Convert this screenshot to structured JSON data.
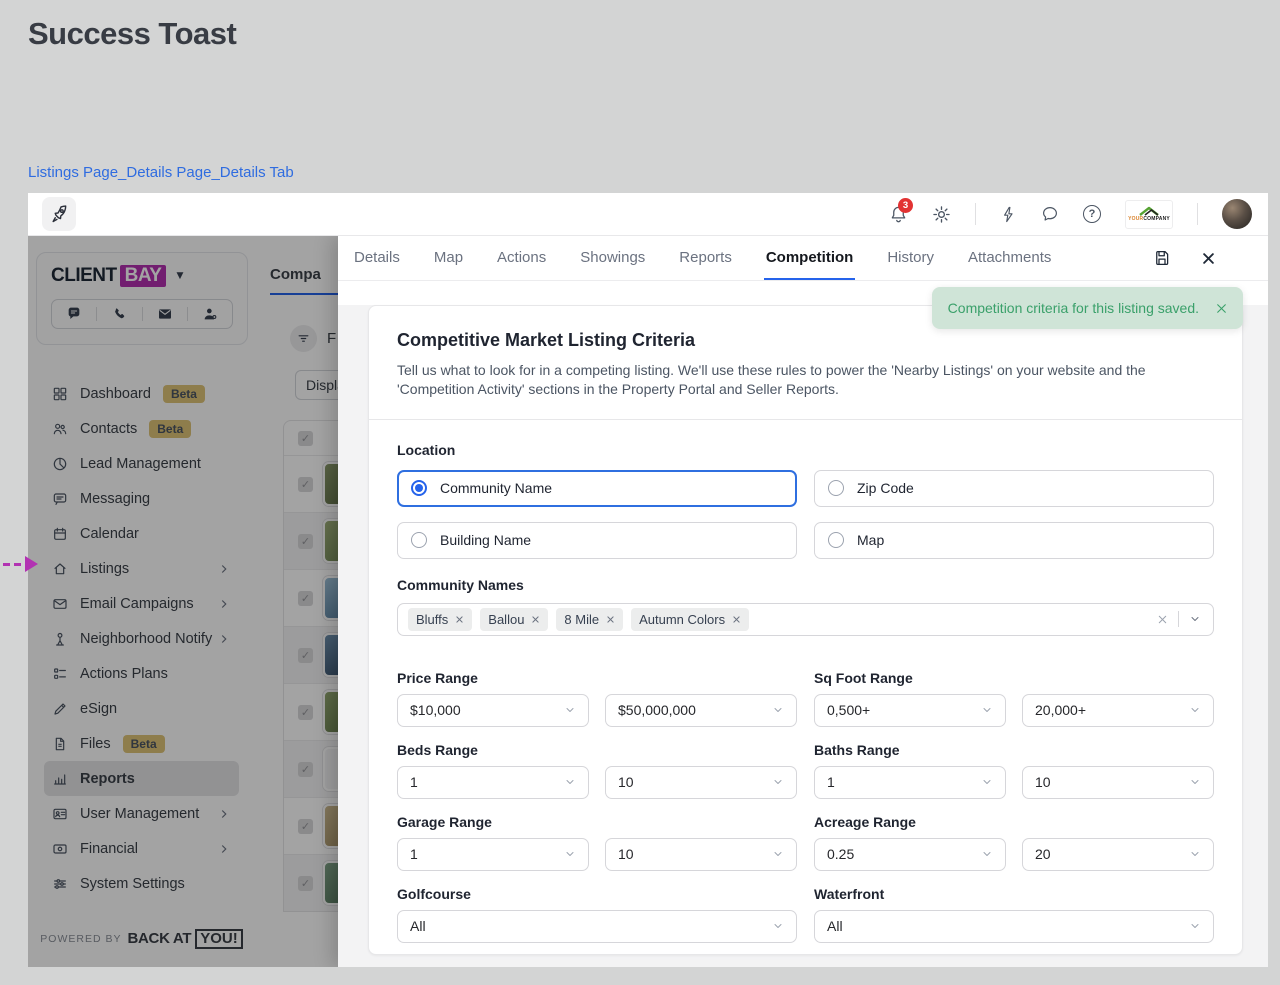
{
  "page": {
    "title": "Success Toast",
    "link_label": "Listings Page_Details Page_Details Tab"
  },
  "topbar": {
    "notification_count": "3",
    "logo_your": "YOUR",
    "logo_company": "COMPANY"
  },
  "sidebar": {
    "logo_client": "CLIENT",
    "logo_bay": "BAY",
    "items": [
      {
        "label": "Dashboard",
        "badge": "Beta"
      },
      {
        "label": "Contacts",
        "badge": "Beta"
      },
      {
        "label": "Lead Management"
      },
      {
        "label": "Messaging"
      },
      {
        "label": "Calendar"
      },
      {
        "label": "Listings"
      },
      {
        "label": "Email Campaigns"
      },
      {
        "label": "Neighborhood Notify"
      },
      {
        "label": "Actions Plans"
      },
      {
        "label": "eSign"
      },
      {
        "label": "Files",
        "badge": "Beta"
      },
      {
        "label": "Reports",
        "selected": true
      },
      {
        "label": "User Management"
      },
      {
        "label": "Financial"
      },
      {
        "label": "System Settings"
      }
    ],
    "powered_by": "POWERED BY",
    "brand_main": "BACK AT",
    "brand_box": "YOU!"
  },
  "background": {
    "tab_label": "Compa",
    "filter_label": "F",
    "display_label": "Displa"
  },
  "tabs": {
    "items": [
      "Details",
      "Map",
      "Actions",
      "Showings",
      "Reports",
      "Competition",
      "History",
      "Attachments"
    ],
    "active": "Competition"
  },
  "toast": {
    "message": "Competition criteria for this listing saved."
  },
  "form": {
    "title": "Competitive Market Listing Criteria",
    "description": "Tell us what to look for in a competing listing. We'll use these rules to power the 'Nearby Listings' on your website and the 'Competition Activity' sections in the Property Portal and Seller Reports.",
    "location_label": "Location",
    "location_options": [
      {
        "label": "Community Name",
        "selected": true
      },
      {
        "label": "Zip Code",
        "selected": false
      },
      {
        "label": "Building Name",
        "selected": false
      },
      {
        "label": "Map",
        "selected": false
      }
    ],
    "community_label": "Community Names",
    "community_tags": [
      "Bluffs",
      "Ballou",
      "8 Mile",
      "Autumn Colors"
    ],
    "ranges": [
      {
        "label": "Price Range",
        "min": "$10,000",
        "max": "$50,000,000"
      },
      {
        "label": "Sq Foot Range",
        "min": "0,500+",
        "max": "20,000+"
      },
      {
        "label": "Beds Range",
        "min": "1",
        "max": "10"
      },
      {
        "label": "Baths Range",
        "min": "1",
        "max": "10"
      },
      {
        "label": "Garage Range",
        "min": "1",
        "max": "10"
      },
      {
        "label": "Acreage Range",
        "min": "0.25",
        "max": "20"
      }
    ],
    "singles": [
      {
        "label": "Golfcourse",
        "value": "All"
      },
      {
        "label": "Waterfront",
        "value": "All"
      }
    ]
  },
  "colors": {
    "accent_blue": "#2563eb",
    "toast_bg": "#cfe4d7",
    "toast_text": "#3aa06a",
    "beta_badge": "#dec478",
    "brand_magenta": "#b32fb0",
    "notification_red": "#e23333"
  }
}
